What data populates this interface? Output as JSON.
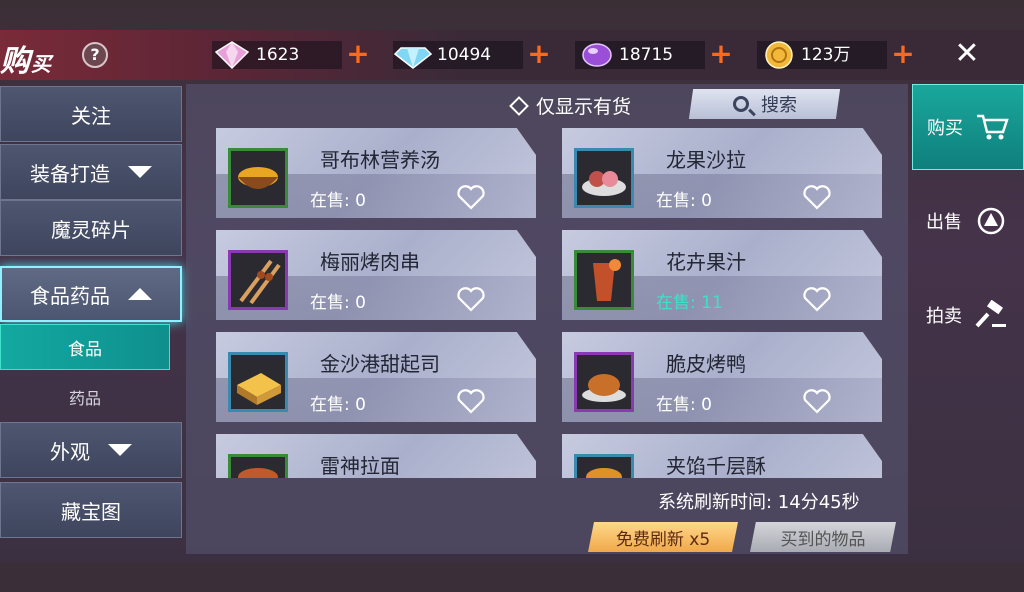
{
  "header": {
    "title_main": "购",
    "title_small": "买",
    "help_label": "?",
    "currencies": [
      {
        "icon": "pink-crystal-icon",
        "value": "1623",
        "plus": "+"
      },
      {
        "icon": "blue-diamond-icon",
        "value": "10494",
        "plus": "+"
      },
      {
        "icon": "purple-gem-icon",
        "value": "18715",
        "plus": "+"
      },
      {
        "icon": "gold-coin-icon",
        "value": "123万",
        "plus": "+"
      }
    ],
    "close_label": "✕"
  },
  "left_menu": {
    "items": [
      {
        "label": "关注"
      },
      {
        "label": "装备打造"
      },
      {
        "label": "魔灵碎片"
      },
      {
        "label": "食品药品"
      },
      {
        "label": "外观"
      },
      {
        "label": "藏宝图"
      }
    ],
    "subitems": [
      {
        "label": "食品"
      },
      {
        "label": "药品"
      }
    ]
  },
  "toolbar": {
    "filter_label": "仅显示有货",
    "search_label": "搜索"
  },
  "items": [
    {
      "name": "哥布林营养汤",
      "stock": "在售: 0",
      "rarity_color": "#3a8a3a",
      "icon": "soup-bowl-icon"
    },
    {
      "name": "龙果沙拉",
      "stock": "在售: 0",
      "rarity_color": "#3a8ab0",
      "icon": "salad-icon"
    },
    {
      "name": "梅丽烤肉串",
      "stock": "在售: 0",
      "rarity_color": "#8a3ab0",
      "icon": "skewer-icon"
    },
    {
      "name": "花卉果汁",
      "stock": "在售: 11",
      "rarity_color": "#3a8a3a",
      "icon": "juice-glass-icon"
    },
    {
      "name": "金沙港甜起司",
      "stock": "在售: 0",
      "rarity_color": "#3a8ab0",
      "icon": "cheese-cake-icon"
    },
    {
      "name": "脆皮烤鸭",
      "stock": "在售: 0",
      "rarity_color": "#8a3ab0",
      "icon": "roast-duck-icon"
    },
    {
      "name": "雷神拉面",
      "stock": "",
      "rarity_color": "#3a8a3a",
      "icon": "noodle-bowl-icon"
    },
    {
      "name": "夹馅千层酥",
      "stock": "",
      "rarity_color": "#3a8ab0",
      "icon": "pastry-icon"
    }
  ],
  "footer": {
    "refresh_text": "系统刷新时间: 14分45秒",
    "free_refresh_label": "免费刷新 x5",
    "bought_label": "买到的物品"
  },
  "right_tabs": [
    {
      "label": "购买"
    },
    {
      "label": "出售"
    },
    {
      "label": "拍卖"
    }
  ]
}
